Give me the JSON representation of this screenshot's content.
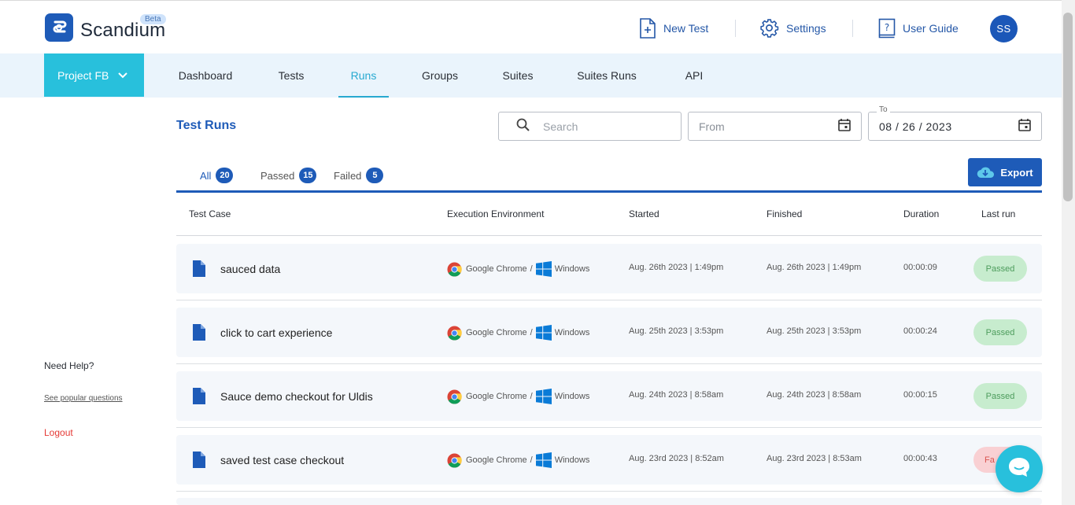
{
  "brand": {
    "name": "Scandium",
    "beta": "Beta",
    "color": "#1e5bb8"
  },
  "header": {
    "new_test": "New Test",
    "settings": "Settings",
    "user_guide": "User Guide",
    "avatar_initials": "SS"
  },
  "nav": {
    "project": "Project FB",
    "tabs": [
      "Dashboard",
      "Tests",
      "Runs",
      "Groups",
      "Suites",
      "Suites Runs",
      "API"
    ],
    "active": "Runs"
  },
  "sidebar": {
    "need_help": "Need Help?",
    "popular": "See popular questions",
    "logout": "Logout"
  },
  "main": {
    "title": "Test Runs",
    "search_placeholder": "Search",
    "from_placeholder": "From",
    "to_label": "To",
    "to_value": "08 / 26 / 2023",
    "filters": [
      {
        "label": "All",
        "count": "20"
      },
      {
        "label": "Passed",
        "count": "15"
      },
      {
        "label": "Failed",
        "count": "5"
      }
    ],
    "export": "Export",
    "columns": [
      "Test Case",
      "Execution Environment",
      "Started",
      "Finished",
      "Duration",
      "Last run"
    ],
    "rows": [
      {
        "name": "sauced data",
        "browser": "Google Chrome",
        "os": "Windows",
        "started": "Aug. 26th 2023 | 1:49pm",
        "finished": "Aug. 26th 2023 | 1:49pm",
        "duration": "00:00:09",
        "status": "Passed"
      },
      {
        "name": "click to cart experience",
        "browser": "Google Chrome",
        "os": "Windows",
        "started": "Aug. 25th 2023 | 3:53pm",
        "finished": "Aug. 25th 2023 | 3:53pm",
        "duration": "00:00:24",
        "status": "Passed"
      },
      {
        "name": "Sauce demo checkout for Uldis",
        "browser": "Google Chrome",
        "os": "Windows",
        "started": "Aug. 24th 2023 | 8:58am",
        "finished": "Aug. 24th 2023 | 8:58am",
        "duration": "00:00:15",
        "status": "Passed"
      },
      {
        "name": "saved test case checkout",
        "browser": "Google Chrome",
        "os": "Windows",
        "started": "Aug. 23rd 2023 | 8:52am",
        "finished": "Aug. 23rd 2023 | 8:53am",
        "duration": "00:00:43",
        "status": "Fa"
      }
    ],
    "status_colors": {
      "passed_bg": "#c7ecce",
      "passed_fg": "#4d9c5c",
      "failed_bg": "#f9d0d3",
      "failed_fg": "#d9534f"
    }
  }
}
